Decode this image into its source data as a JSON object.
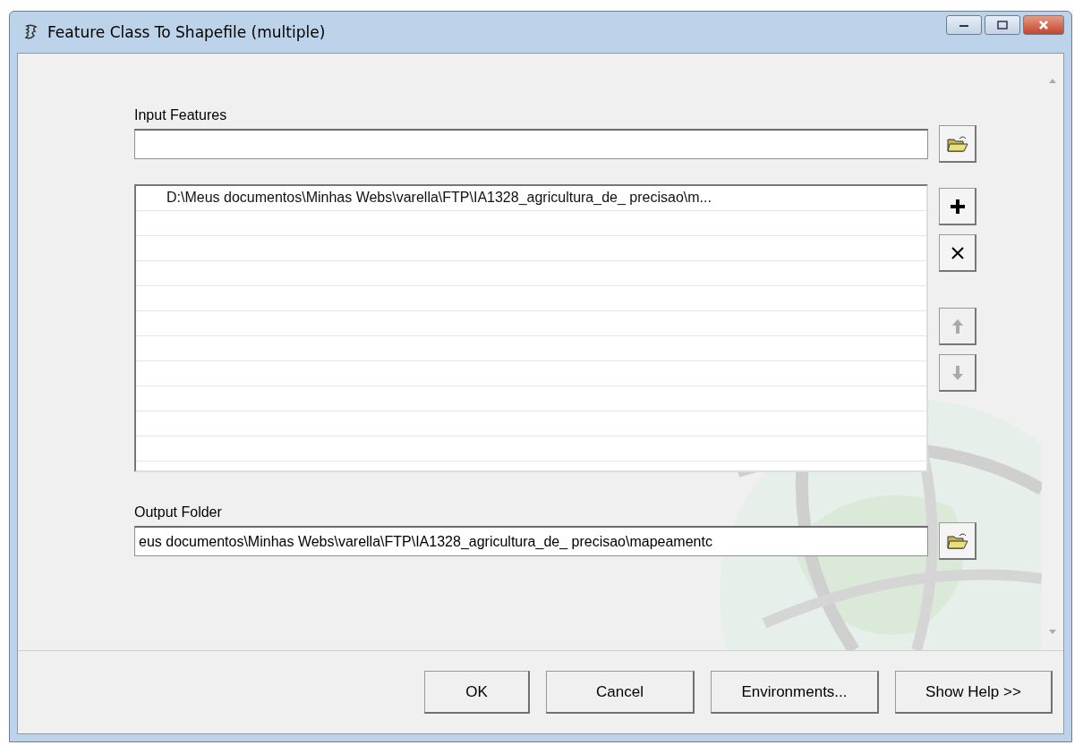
{
  "window": {
    "title": "Feature Class To Shapefile (multiple)"
  },
  "input_features": {
    "label": "Input Features"
  },
  "feature_list": {
    "items": [
      {
        "text": "D:\\Meus documentos\\Minhas Webs\\varella\\FTP\\IA1328_agricultura_de_ precisao\\m..."
      }
    ],
    "tools": [
      {
        "kind": "add",
        "disabled": false
      },
      {
        "kind": "remove",
        "disabled": false
      },
      {
        "kind": "up",
        "disabled": true
      },
      {
        "kind": "down",
        "disabled": true
      }
    ]
  },
  "output_folder": {
    "label": "Output Folder",
    "value": "eus documentos\\Minhas Webs\\varella\\FTP\\IA1328_agricultura_de_ precisao\\mapeamentc"
  },
  "buttons": [
    "OK",
    "Cancel",
    "Environments...",
    "Show Help >>"
  ]
}
